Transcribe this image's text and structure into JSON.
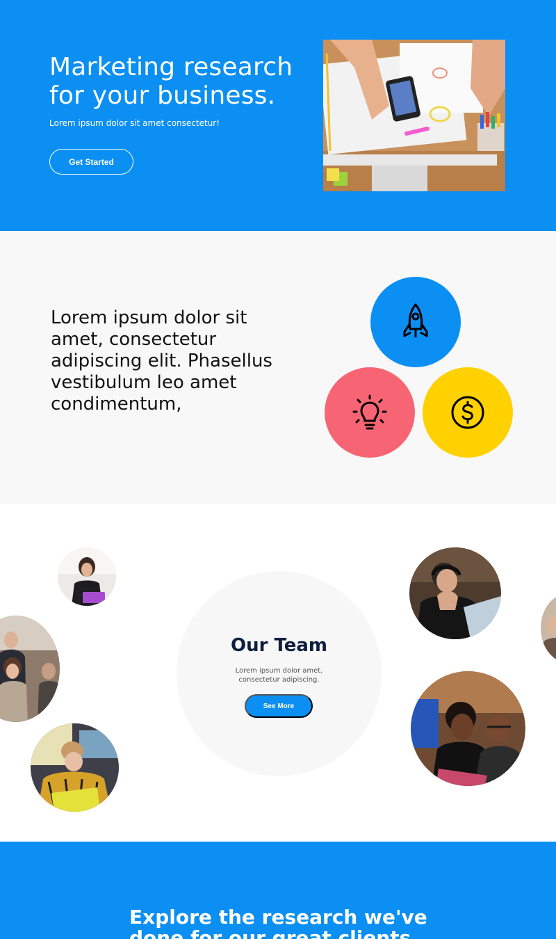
{
  "hero": {
    "title": "Marketing research for your business.",
    "subtitle": "Lorem ipsum dolor sit amet consectetur!",
    "cta_label": "Get Started"
  },
  "features": {
    "text": "Lorem ipsum dolor sit amet, consectetur adipiscing elit. Phasellus vestibulum leo amet condimentum,",
    "icons": [
      "rocket-icon",
      "lightbulb-icon",
      "dollar-coin-icon"
    ]
  },
  "team": {
    "title": "Our Team",
    "subtitle": "Lorem ipsum dolor amet, consectetur adipiscing.",
    "button_label": "See More"
  },
  "explore": {
    "title": "Explore the research we've done for our great clients"
  },
  "colors": {
    "primary": "#0b8ff2",
    "pink": "#f76575",
    "yellow": "#ffd100",
    "navy": "#0e1f3d",
    "light_bg": "#f8f8f8"
  }
}
